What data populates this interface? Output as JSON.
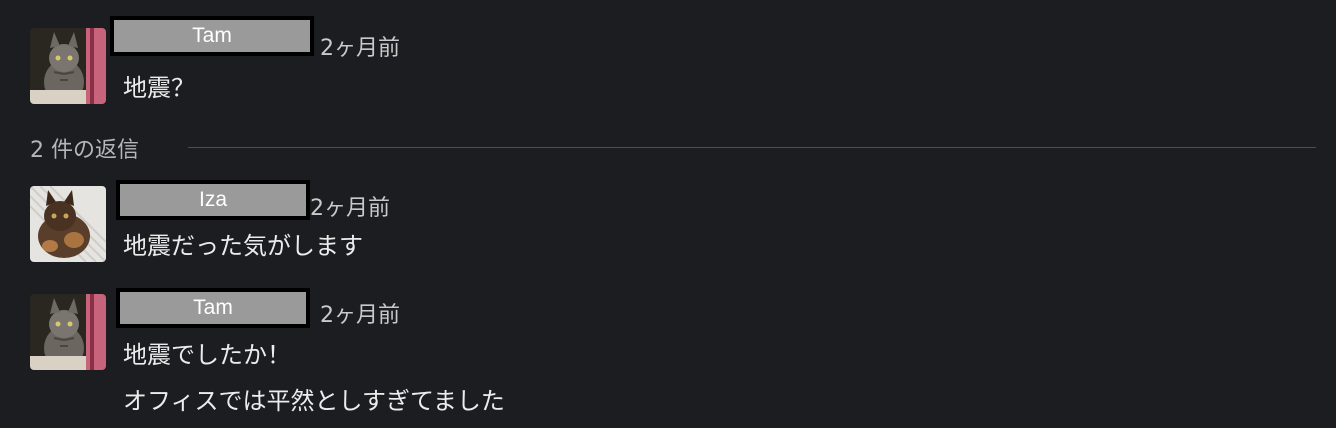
{
  "comments": [
    {
      "author": "Tam",
      "time": "2ヶ月前",
      "lines": [
        "地震？"
      ]
    },
    {
      "author": "Iza",
      "time": "2ヶ月前",
      "lines": [
        "地震だった気がします"
      ]
    },
    {
      "author": "Tam",
      "time": "2ヶ月前",
      "lines": [
        "地震でしたか！",
        "オフィスでは平然としすぎてました"
      ]
    }
  ],
  "replies": {
    "label": "2 件の返信"
  },
  "colors": {
    "background": "#1b1d20",
    "name_box": "#9a9a9a",
    "divider": "#4a4d52"
  }
}
